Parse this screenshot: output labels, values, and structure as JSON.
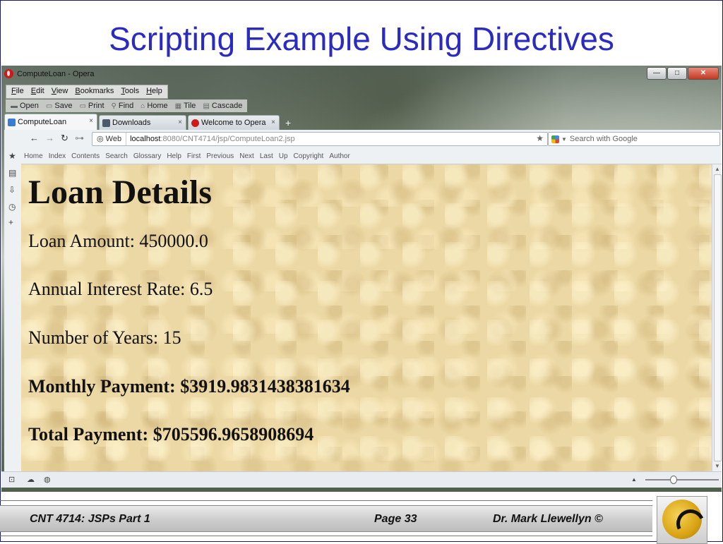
{
  "slide": {
    "title": "Scripting Example Using Directives",
    "footer_left": "CNT 4714:  JSPs Part 1",
    "footer_page": "Page 33",
    "footer_author": "Dr. Mark Llewellyn ©"
  },
  "window": {
    "title": "ComputeLoan - Opera",
    "controls": {
      "minimize": "—",
      "maximize": "□",
      "close": "✕"
    }
  },
  "menubar": {
    "items": [
      {
        "underline": "F",
        "rest": "ile"
      },
      {
        "underline": "E",
        "rest": "dit"
      },
      {
        "underline": "V",
        "rest": "iew"
      },
      {
        "underline": "B",
        "rest": "ookmarks"
      },
      {
        "underline": "T",
        "rest": "ools"
      },
      {
        "underline": "H",
        "rest": "elp"
      }
    ]
  },
  "toolbar": {
    "open": "Open",
    "save": "Save",
    "print": "Print",
    "find": "Find",
    "home": "Home",
    "tile": "Tile",
    "cascade": "Cascade"
  },
  "tabs": [
    {
      "label": "ComputeLoan",
      "close": "×",
      "icon_color": "#3a7bd5"
    },
    {
      "label": "Downloads",
      "close": "×",
      "icon_color": "#4a5a6a"
    },
    {
      "label": "Welcome to Opera",
      "close": "×",
      "icon_color": "#cc1a1a"
    }
  ],
  "add_tab": "+",
  "address": {
    "web_label": "Web",
    "url_host": "localhost",
    "url_rest": ":8080/CNT4714/jsp/ComputeLoan2.jsp",
    "search_placeholder": "Search with Google"
  },
  "navbar": {
    "links": [
      "Home",
      "Index",
      "Contents",
      "Search",
      "Glossary",
      "Help",
      "First",
      "Previous",
      "Next",
      "Last",
      "Up",
      "Copyright",
      "Author"
    ]
  },
  "page": {
    "heading": "Loan Details",
    "loan_amount": "Loan Amount: 450000.0",
    "interest_rate": "Annual Interest Rate: 6.5",
    "years": "Number of Years: 15",
    "monthly_payment": "Monthly Payment: $3919.9831438381634",
    "total_payment": "Total Payment: $705596.9658908694"
  }
}
